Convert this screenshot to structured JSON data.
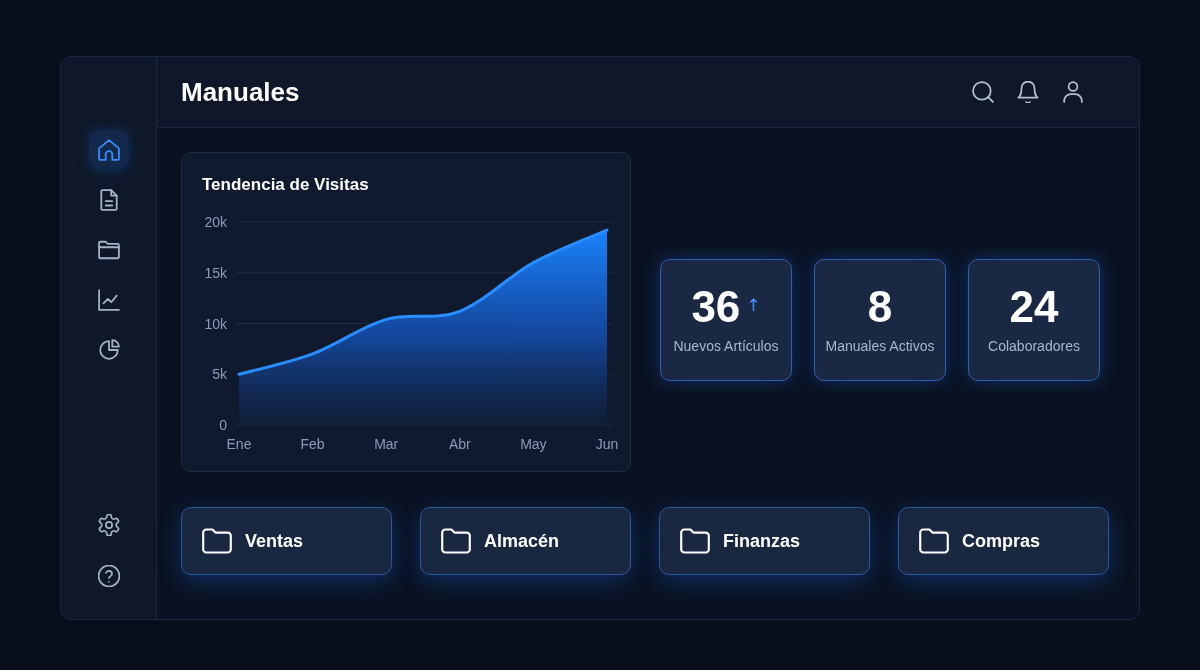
{
  "header": {
    "title": "Manuales"
  },
  "sidebar": {
    "items": [
      {
        "selected": true
      },
      {
        "selected": false
      },
      {
        "selected": false
      },
      {
        "selected": false
      },
      {
        "selected": false
      }
    ]
  },
  "visits_chart": {
    "chart_data": {
      "type": "area",
      "title": "Tendencia de Visitas",
      "categories": [
        "Ene",
        "Feb",
        "Mar",
        "Abr",
        "May",
        "Jun"
      ],
      "values": [
        5000,
        7000,
        10400,
        11200,
        16000,
        19200
      ],
      "ylim": [
        0,
        20000
      ],
      "yticks": [
        {
          "value": 0,
          "label": "0"
        },
        {
          "value": 5000,
          "label": "5k"
        },
        {
          "value": 10000,
          "label": "10k"
        },
        {
          "value": 15000,
          "label": "15k"
        },
        {
          "value": 20000,
          "label": "20k"
        }
      ],
      "grid": true
    }
  },
  "stats": [
    {
      "value": "36",
      "label": "Nuevos Artículos",
      "indicator": "↑"
    },
    {
      "value": "8",
      "label": "Manuales Activos"
    },
    {
      "value": "24",
      "label": "Colaboradores"
    }
  ],
  "folders": [
    {
      "label": "Ventas"
    },
    {
      "label": "Almacén"
    },
    {
      "label": "Finanzas"
    },
    {
      "label": "Compras"
    }
  ]
}
